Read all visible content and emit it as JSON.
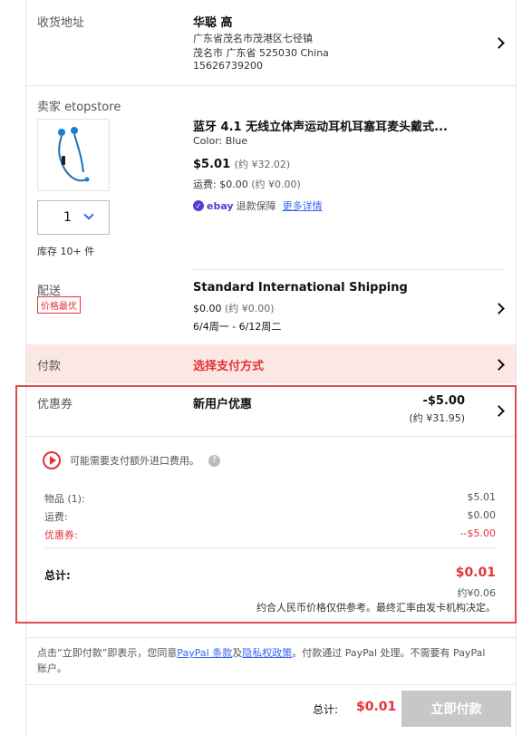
{
  "address": {
    "label": "收货地址",
    "name": "华聪 高",
    "line1": "广东省茂名市茂港区七径镇",
    "line2": "茂名市 广东省 525030 China",
    "phone": "15626739200"
  },
  "item": {
    "seller": "卖家 etopstore",
    "title": "蓝牙 4.1 无线立体声运动耳机耳塞耳麦头戴式...",
    "color": "Color: Blue",
    "price": "$5.01",
    "price_approx": "(约 ¥32.02)",
    "shipping_label": "运费:",
    "shipping_value": "$0.00",
    "shipping_approx": "(约 ¥0.00)",
    "quantity": "1",
    "stock": "库存 10+ 件",
    "guarantee_brand": "ebay",
    "guarantee_text": "退款保障",
    "details_link": "更多详情"
  },
  "shipping": {
    "label": "配送",
    "badge": "价格最优",
    "method": "Standard International Shipping",
    "cost": "$0.00",
    "cost_approx": "(约 ¥0.00)",
    "dates": "6/4周一 - 6/12周二"
  },
  "payment": {
    "label": "付款",
    "select": "选择支付方式"
  },
  "coupon": {
    "label": "优惠券",
    "name": "新用户优惠",
    "amount": "-$5.00",
    "approx": "(约 ¥31.95)"
  },
  "summary": {
    "import_note": "可能需要支付额外进口费用。",
    "items_label": "物品 (1):",
    "items_value": "$5.01",
    "shipping_label": "运费:",
    "shipping_value": "$0.00",
    "coupon_label": "优惠券:",
    "coupon_value": "--$5.00",
    "total_label": "总计:",
    "total_value": "$0.01",
    "total_approx": "约¥0.06",
    "fx_note": "约合人民币价格仅供参考。最终汇率由发卡机构决定。"
  },
  "agreement": {
    "prefix": "点击“立即付款”即表示，您同意",
    "terms_link": "PayPal 条款",
    "and": "及",
    "privacy_link": "隐私权政策",
    "suffix": "。付款通过 PayPal 处理。不需要有 PayPal 账户。"
  },
  "bottom": {
    "total_label": "总计:",
    "total_value": "$0.01",
    "pay_button": "立即付款"
  },
  "colors": {
    "accent_red": "#e53238",
    "link_blue": "#3665f3",
    "ebay_purple": "#5b3bd6",
    "payment_bg": "#fbe7e3",
    "disabled_button": "#c7c7c7"
  }
}
